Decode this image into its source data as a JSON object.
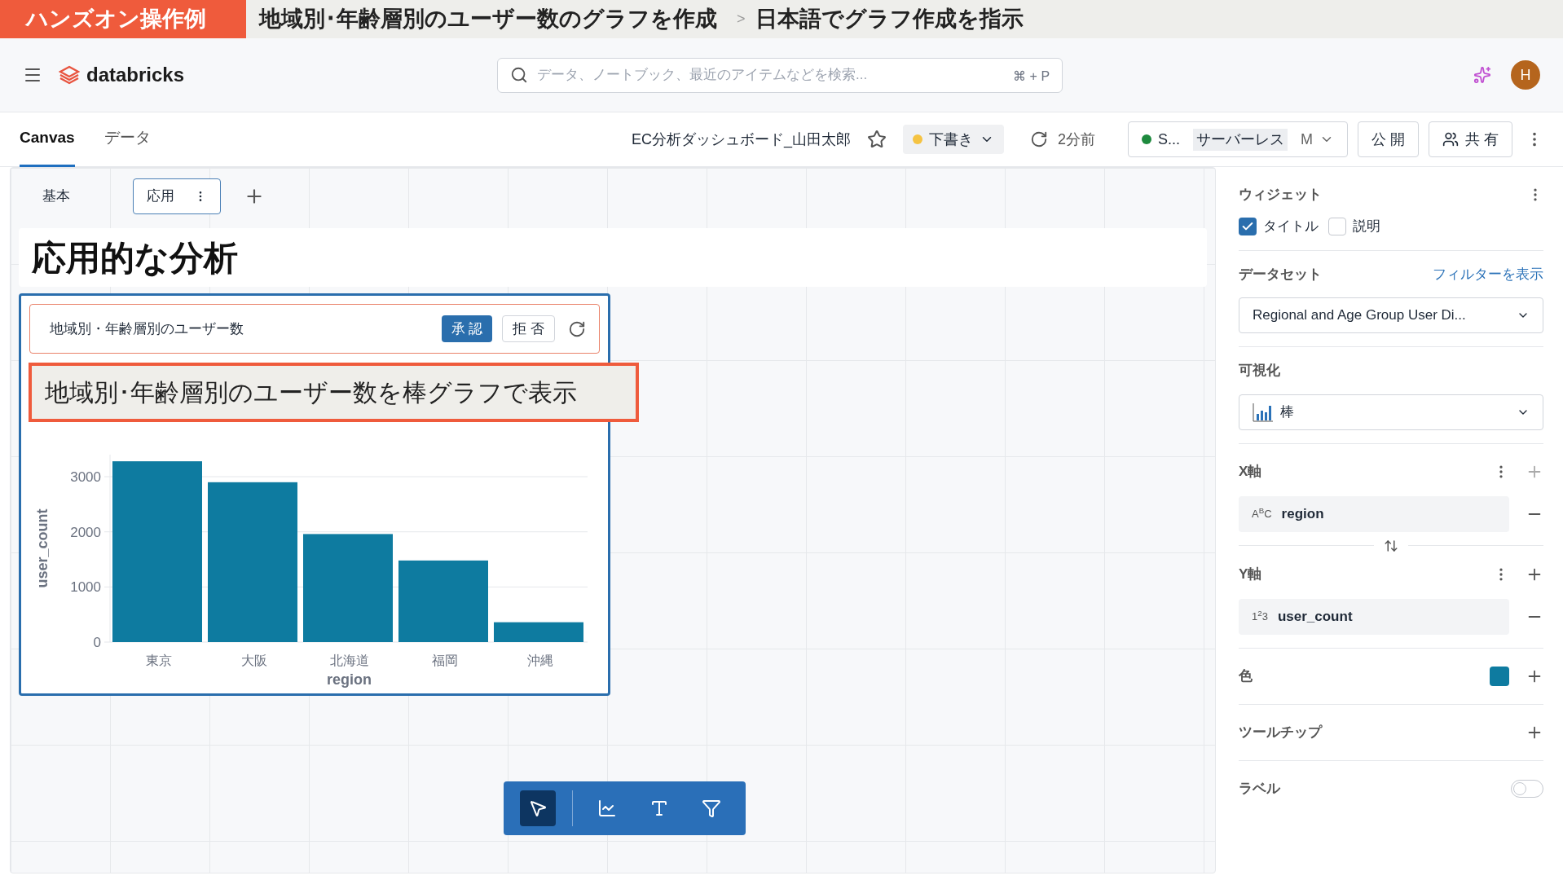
{
  "banner": {
    "badge": "ハンズオン操作例",
    "title": "地域別･年齢層別のユーザー数のグラフを作成",
    "separator": ">",
    "subtitle": "日本語でグラフ作成を指示"
  },
  "header": {
    "logo": "databricks",
    "search": {
      "placeholder": "データ、ノートブック、最近のアイテムなどを検索...",
      "shortcut": "⌘ + P"
    },
    "avatar": "H"
  },
  "tabs": [
    {
      "label": "Canvas",
      "selected": true
    },
    {
      "label": "データ",
      "selected": false
    }
  ],
  "dashboard": {
    "title": "EC分析ダッシュボード_山田太郎",
    "status": "下書き",
    "updated": "2分前",
    "compute": "S...",
    "compute_type": "サーバーレス",
    "compute_size": "M",
    "publish": "公 開",
    "share": "共 有"
  },
  "pages": [
    {
      "label": "基本",
      "selected": false
    },
    {
      "label": "応用",
      "selected": true
    }
  ],
  "heading": "応用的な分析",
  "widget": {
    "prompt": "地域別・年齢層別のユーザー数",
    "approve": "承 認",
    "reject": "拒 否",
    "chart_data": {
      "type": "bar",
      "xlabel": "region",
      "ylabel": "user_count",
      "categories": [
        "東京",
        "大阪",
        "北海道",
        "福岡",
        "沖縄"
      ],
      "series": [
        {
          "color": "#0e7ba0",
          "values": [
            3280,
            2900,
            1960,
            1480,
            360
          ]
        }
      ],
      "ylim": [
        0,
        3400
      ],
      "yticks": [
        0,
        1000,
        2000,
        3000
      ],
      "grid": true
    }
  },
  "annotation": "地域別･年齢層別のユーザー数を棒グラフで表示",
  "tools": [
    {
      "kind": "pointer",
      "selected": true
    },
    {
      "kind": "chart",
      "selected": false
    },
    {
      "kind": "text",
      "selected": false
    },
    {
      "kind": "filter",
      "selected": false
    }
  ],
  "panel": {
    "widget_label": "ウィジェット",
    "options": [
      {
        "label": "タイトル",
        "checked": true
      },
      {
        "label": "説明",
        "checked": false
      }
    ],
    "dataset_label": "データセット",
    "filter_link": "フィルターを表示",
    "dataset": "Regional and Age Group User Di...",
    "viz_label": "可視化",
    "viz": "棒",
    "x_label": "X軸",
    "x_type": "A$^{B}$C",
    "x_field": "region",
    "y_type": "1$^{2}$3",
    "y_label": "Y軸",
    "y_field": "user_count",
    "color_label": "色",
    "color": "#0e7ba0",
    "tooltip_label": "ツールチップ",
    "data_label": "ラベル",
    "data_label_on": false
  }
}
